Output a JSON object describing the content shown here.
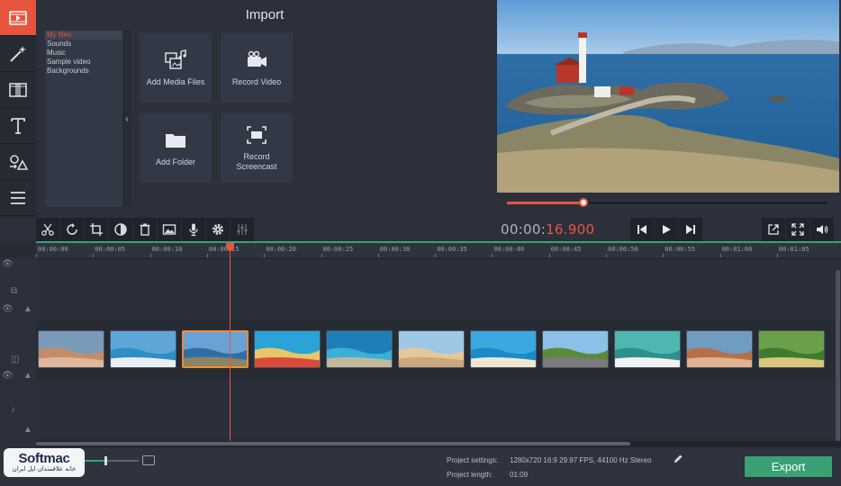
{
  "import": {
    "title": "Import",
    "categories": [
      "My files",
      "Sounds",
      "Music",
      "Sample video",
      "Backgrounds"
    ],
    "tiles": [
      {
        "label": "Add Media Files",
        "icon": "add-media-icon"
      },
      {
        "label": "Record Video",
        "icon": "video-camera-icon"
      },
      {
        "label": "Add Folder",
        "icon": "folder-icon"
      },
      {
        "label": "Record Screencast",
        "icon": "screencast-icon"
      }
    ]
  },
  "side_toolbar": [
    {
      "icon": "import-media-icon",
      "active": true
    },
    {
      "icon": "magic-wand-icon",
      "active": false
    },
    {
      "icon": "transitions-icon",
      "active": false
    },
    {
      "icon": "titles-icon",
      "active": false
    },
    {
      "icon": "shapes-icon",
      "active": false
    },
    {
      "icon": "more-tools-icon",
      "active": false
    }
  ],
  "edit_toolbar": [
    "scissors-icon",
    "rotate-icon",
    "crop-icon",
    "color-adjust-icon",
    "trash-icon",
    "image-icon",
    "microphone-icon",
    "settings-icon",
    "equalizer-icon"
  ],
  "player": {
    "timecode_base": "00:00:",
    "timecode_accent": "16.900",
    "progress": 0.24
  },
  "transport": [
    "skip-back-icon",
    "play-icon",
    "skip-forward-icon"
  ],
  "view_controls": [
    "detach-icon",
    "fullscreen-icon",
    "volume-icon"
  ],
  "timeline": {
    "ruler_ticks": [
      "00:00:00",
      "00:00:05",
      "00:00:10",
      "00:00:15",
      "00:00:20",
      "00:00:25",
      "00:00:30",
      "00:00:35",
      "00:00:40",
      "00:00:45",
      "00:00:50",
      "00:00:55",
      "00:01:00",
      "00:01:05"
    ],
    "clip_count": 11,
    "selected_clip": 2
  },
  "status": {
    "watermark_logo": "Softmac",
    "watermark_sub": "خانه علاقمندان اپل ایران",
    "project_settings_label": "Project settings:",
    "project_settings_value": "1280x720 16:9 29.97 FPS, 44100 Hz Stereo",
    "project_length_label": "Project length:",
    "project_length_value": "01:09",
    "export_label": "Export"
  },
  "colors": {
    "accent": "#e8553f",
    "export_green": "#3aa174",
    "background": "#2b303b"
  }
}
